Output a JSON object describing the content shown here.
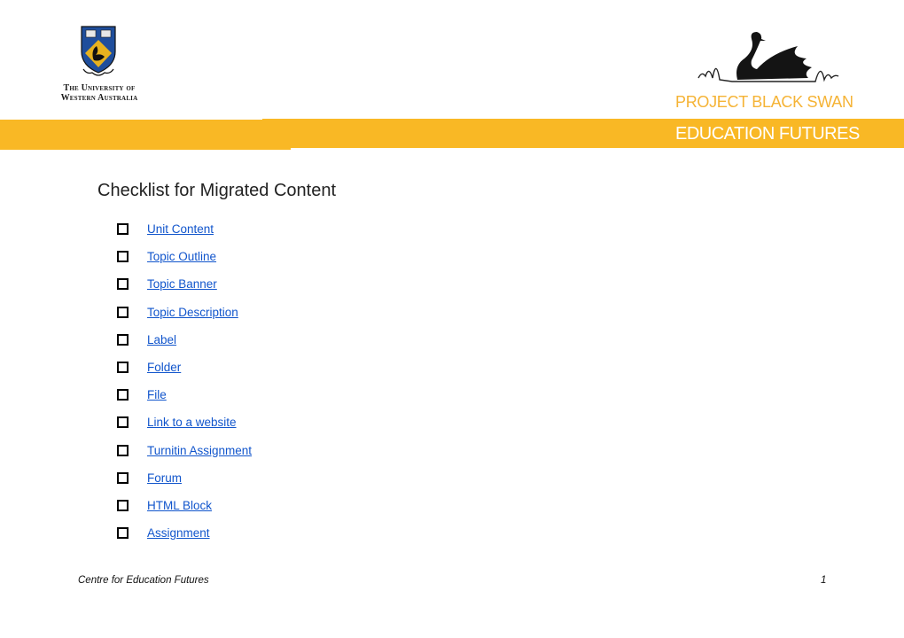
{
  "header": {
    "university_name_line1": "The University of",
    "university_name_line2": "Western Australia",
    "project_title": "PROJECT BLACK SWAN",
    "banner_title": "EDUCATION FUTURES",
    "brand_color": "#f9b825"
  },
  "main": {
    "title": "Checklist for Migrated Content",
    "items": [
      {
        "label": "Unit Content",
        "checked": false
      },
      {
        "label": "Topic Outline",
        "checked": false
      },
      {
        "label": "Topic Banner",
        "checked": false
      },
      {
        "label": "Topic Description",
        "checked": false
      },
      {
        "label": "Label",
        "checked": false
      },
      {
        "label": "Folder",
        "checked": false
      },
      {
        "label": "File",
        "checked": false
      },
      {
        "label": "Link to a website",
        "checked": false
      },
      {
        "label": "Turnitin Assignment",
        "checked": false
      },
      {
        "label": "Forum",
        "checked": false
      },
      {
        "label": "HTML Block",
        "checked": false
      },
      {
        "label": "Assignment",
        "checked": false
      }
    ]
  },
  "footer": {
    "left": "Centre for Education Futures",
    "page_number": "1"
  }
}
